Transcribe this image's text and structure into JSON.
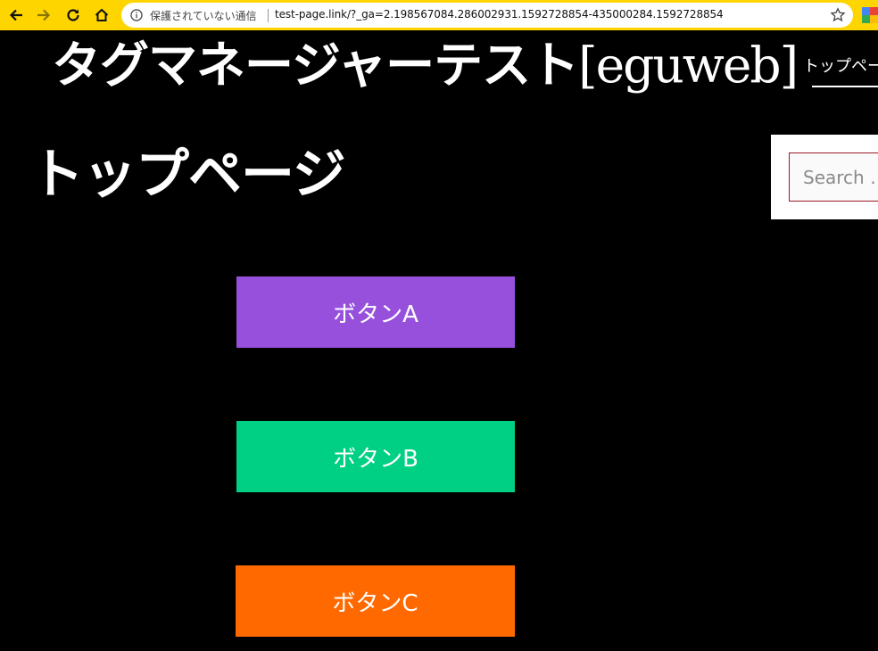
{
  "browser": {
    "security_label": "保護されていない通信",
    "url": "test-page.link/?_ga=2.198567084.286002931.1592728854-435000284.1592728854",
    "accent_color": "#ffd500"
  },
  "site": {
    "title_jp": "タグマネージャーテスト",
    "title_latin": "[eguweb]",
    "nav_item": "トップペー"
  },
  "page": {
    "title": "トップページ"
  },
  "search": {
    "placeholder": "Search …"
  },
  "buttons": [
    {
      "label": "ボタンA",
      "color": "#9650dc"
    },
    {
      "label": "ボタンB",
      "color": "#00d084"
    },
    {
      "label": "ボタンC",
      "color": "#ff6900"
    }
  ]
}
